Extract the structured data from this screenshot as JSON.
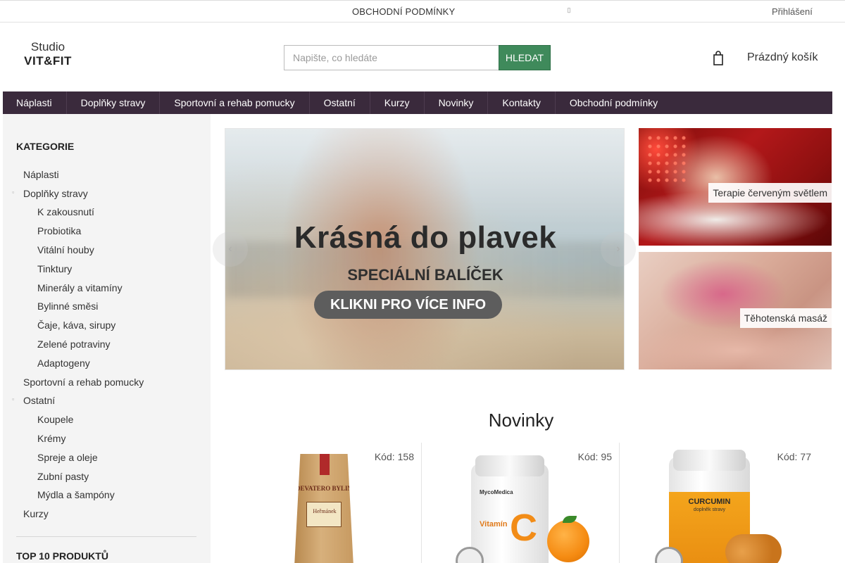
{
  "topbar": {
    "terms_link": "OBCHODNÍ PODMÍNKY",
    "lang_icon": "globe-icon",
    "login_link": "Přihlášení"
  },
  "header": {
    "logo_line1": "Studio",
    "logo_line2": "VIT&FIT",
    "search_placeholder": "Napište, co hledáte",
    "search_button": "HLEDAT",
    "cart_icon": "shopping-cart-icon",
    "cart_label": "Prázdný košík",
    "accent_color": "#3f8a5b"
  },
  "nav": {
    "background_color": "#3a2a3c",
    "items": [
      "Náplasti",
      "Doplňky stravy",
      "Sportovní a rehab pomucky",
      "Ostatní",
      "Kurzy",
      "Novinky",
      "Kontakty",
      "Obchodní podmínky"
    ]
  },
  "sidebar": {
    "title": "KATEGORIE",
    "categories": {
      "naplasti": "Náplasti",
      "doplnky": "Doplňky stravy",
      "k_zakousnuti": "K zakousnutí",
      "probiotika": "Probiotika",
      "vitalni_houby": "Vitální houby",
      "tinktury": "Tinktury",
      "mineraly": "Minerály a vitamíny",
      "bylinne": "Bylinné směsi",
      "caje": "Čaje, káva, sirupy",
      "zelene": "Zelené potraviny",
      "adaptogeny": "Adaptogeny",
      "sportovni": "Sportovní a rehab pomucky",
      "ostatni": "Ostatní",
      "koupele": "Koupele",
      "kremy": "Krémy",
      "spreje": "Spreje a oleje",
      "zubni": "Zubní pasty",
      "mydla": "Mýdla a šampóny",
      "kurzy": "Kurzy"
    },
    "top10_title": "TOP 10 PRODUKTŮ"
  },
  "slider": {
    "headline": "Krásná do plavek",
    "subheadline": "SPECIÁLNÍ BALÍČEK",
    "cta": "KLIKNI PRO VÍCE INFO"
  },
  "promos": [
    {
      "caption": "Terapie červeným světlem"
    },
    {
      "caption": "Těhotenská masáž"
    }
  ],
  "novinky": {
    "title": "Novinky",
    "products": [
      {
        "code_label": "Kód:",
        "code": "158",
        "brand": "DEVATERO BYLIN",
        "label": "Heřmánek"
      },
      {
        "code_label": "Kód:",
        "code": "95",
        "brand": "MycoMedica",
        "label": "Vitamín",
        "letter": "C"
      },
      {
        "code_label": "Kód:",
        "code": "77",
        "label": "CURCUMIN",
        "sub": "doplněk stravy"
      }
    ]
  }
}
